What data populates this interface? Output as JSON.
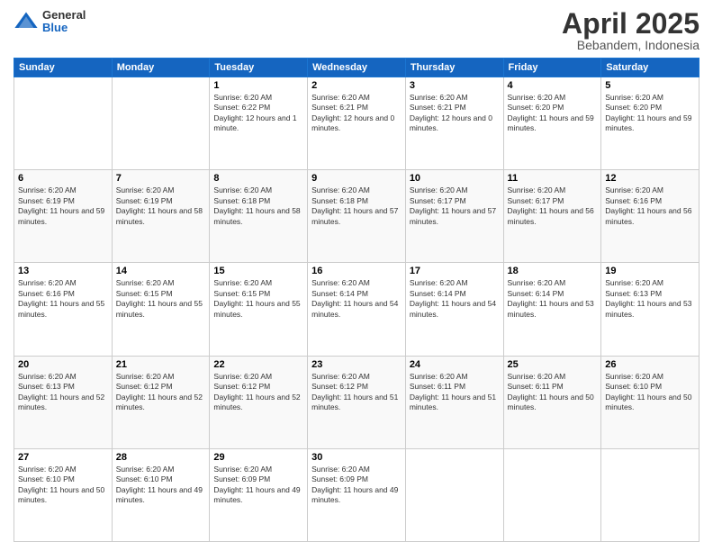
{
  "header": {
    "logo_general": "General",
    "logo_blue": "Blue",
    "title": "April 2025",
    "location": "Bebandem, Indonesia"
  },
  "days_of_week": [
    "Sunday",
    "Monday",
    "Tuesday",
    "Wednesday",
    "Thursday",
    "Friday",
    "Saturday"
  ],
  "weeks": [
    [
      {
        "day": "",
        "info": ""
      },
      {
        "day": "",
        "info": ""
      },
      {
        "day": "1",
        "info": "Sunrise: 6:20 AM\nSunset: 6:22 PM\nDaylight: 12 hours and 1 minute."
      },
      {
        "day": "2",
        "info": "Sunrise: 6:20 AM\nSunset: 6:21 PM\nDaylight: 12 hours and 0 minutes."
      },
      {
        "day": "3",
        "info": "Sunrise: 6:20 AM\nSunset: 6:21 PM\nDaylight: 12 hours and 0 minutes."
      },
      {
        "day": "4",
        "info": "Sunrise: 6:20 AM\nSunset: 6:20 PM\nDaylight: 11 hours and 59 minutes."
      },
      {
        "day": "5",
        "info": "Sunrise: 6:20 AM\nSunset: 6:20 PM\nDaylight: 11 hours and 59 minutes."
      }
    ],
    [
      {
        "day": "6",
        "info": "Sunrise: 6:20 AM\nSunset: 6:19 PM\nDaylight: 11 hours and 59 minutes."
      },
      {
        "day": "7",
        "info": "Sunrise: 6:20 AM\nSunset: 6:19 PM\nDaylight: 11 hours and 58 minutes."
      },
      {
        "day": "8",
        "info": "Sunrise: 6:20 AM\nSunset: 6:18 PM\nDaylight: 11 hours and 58 minutes."
      },
      {
        "day": "9",
        "info": "Sunrise: 6:20 AM\nSunset: 6:18 PM\nDaylight: 11 hours and 57 minutes."
      },
      {
        "day": "10",
        "info": "Sunrise: 6:20 AM\nSunset: 6:17 PM\nDaylight: 11 hours and 57 minutes."
      },
      {
        "day": "11",
        "info": "Sunrise: 6:20 AM\nSunset: 6:17 PM\nDaylight: 11 hours and 56 minutes."
      },
      {
        "day": "12",
        "info": "Sunrise: 6:20 AM\nSunset: 6:16 PM\nDaylight: 11 hours and 56 minutes."
      }
    ],
    [
      {
        "day": "13",
        "info": "Sunrise: 6:20 AM\nSunset: 6:16 PM\nDaylight: 11 hours and 55 minutes."
      },
      {
        "day": "14",
        "info": "Sunrise: 6:20 AM\nSunset: 6:15 PM\nDaylight: 11 hours and 55 minutes."
      },
      {
        "day": "15",
        "info": "Sunrise: 6:20 AM\nSunset: 6:15 PM\nDaylight: 11 hours and 55 minutes."
      },
      {
        "day": "16",
        "info": "Sunrise: 6:20 AM\nSunset: 6:14 PM\nDaylight: 11 hours and 54 minutes."
      },
      {
        "day": "17",
        "info": "Sunrise: 6:20 AM\nSunset: 6:14 PM\nDaylight: 11 hours and 54 minutes."
      },
      {
        "day": "18",
        "info": "Sunrise: 6:20 AM\nSunset: 6:14 PM\nDaylight: 11 hours and 53 minutes."
      },
      {
        "day": "19",
        "info": "Sunrise: 6:20 AM\nSunset: 6:13 PM\nDaylight: 11 hours and 53 minutes."
      }
    ],
    [
      {
        "day": "20",
        "info": "Sunrise: 6:20 AM\nSunset: 6:13 PM\nDaylight: 11 hours and 52 minutes."
      },
      {
        "day": "21",
        "info": "Sunrise: 6:20 AM\nSunset: 6:12 PM\nDaylight: 11 hours and 52 minutes."
      },
      {
        "day": "22",
        "info": "Sunrise: 6:20 AM\nSunset: 6:12 PM\nDaylight: 11 hours and 52 minutes."
      },
      {
        "day": "23",
        "info": "Sunrise: 6:20 AM\nSunset: 6:12 PM\nDaylight: 11 hours and 51 minutes."
      },
      {
        "day": "24",
        "info": "Sunrise: 6:20 AM\nSunset: 6:11 PM\nDaylight: 11 hours and 51 minutes."
      },
      {
        "day": "25",
        "info": "Sunrise: 6:20 AM\nSunset: 6:11 PM\nDaylight: 11 hours and 50 minutes."
      },
      {
        "day": "26",
        "info": "Sunrise: 6:20 AM\nSunset: 6:10 PM\nDaylight: 11 hours and 50 minutes."
      }
    ],
    [
      {
        "day": "27",
        "info": "Sunrise: 6:20 AM\nSunset: 6:10 PM\nDaylight: 11 hours and 50 minutes."
      },
      {
        "day": "28",
        "info": "Sunrise: 6:20 AM\nSunset: 6:10 PM\nDaylight: 11 hours and 49 minutes."
      },
      {
        "day": "29",
        "info": "Sunrise: 6:20 AM\nSunset: 6:09 PM\nDaylight: 11 hours and 49 minutes."
      },
      {
        "day": "30",
        "info": "Sunrise: 6:20 AM\nSunset: 6:09 PM\nDaylight: 11 hours and 49 minutes."
      },
      {
        "day": "",
        "info": ""
      },
      {
        "day": "",
        "info": ""
      },
      {
        "day": "",
        "info": ""
      }
    ]
  ]
}
